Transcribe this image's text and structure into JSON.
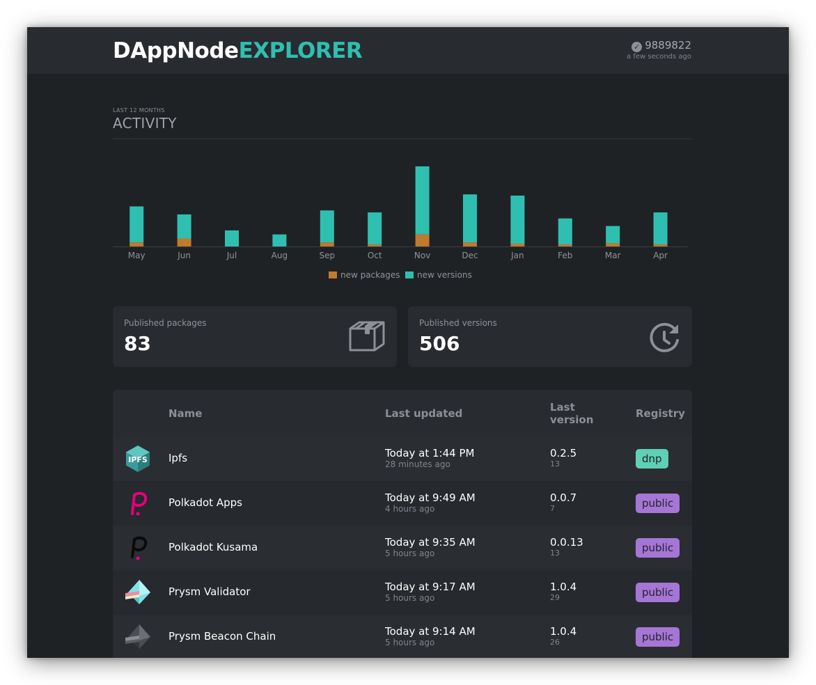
{
  "header": {
    "logo_main": "DAppNode",
    "logo_accent": "EXPLORER",
    "block_number": "9889822",
    "block_time": "a few seconds ago"
  },
  "activity": {
    "subtitle": "LAST 12 MONTHS",
    "title": "ACTIVITY"
  },
  "chart_data": {
    "type": "bar",
    "stacked": true,
    "categories": [
      "May",
      "Jun",
      "Jul",
      "Aug",
      "Sep",
      "Oct",
      "Nov",
      "Dec",
      "Jan",
      "Feb",
      "Mar",
      "Apr"
    ],
    "series": [
      {
        "name": "new packages",
        "color": "#c07a2c",
        "values": [
          1,
          2,
          0,
          0,
          1,
          0.5,
          3,
          1,
          0.7,
          0.5,
          0.8,
          0.5
        ]
      },
      {
        "name": "new versions",
        "color": "#2fbfb0",
        "values": [
          9,
          6,
          4,
          3,
          8,
          8,
          17,
          12,
          12,
          6.5,
          4.3,
          8
        ]
      }
    ],
    "legend_position": "bottom-center",
    "ylim": [
      0,
      20
    ],
    "grid": false
  },
  "stats": {
    "packages_label": "Published packages",
    "packages_value": "83",
    "versions_label": "Published versions",
    "versions_value": "506"
  },
  "table": {
    "headers": {
      "name": "Name",
      "updated": "Last updated",
      "version_line1": "Last",
      "version_line2": "version",
      "registry": "Registry"
    },
    "rows": [
      {
        "icon": "ipfs-icon",
        "name": "Ipfs",
        "updated": "Today at 1:44 PM",
        "ago": "28 minutes ago",
        "version": "0.2.5",
        "count": "13",
        "registry": "dnp",
        "registry_color": "#5fcfb5"
      },
      {
        "icon": "polkadot-apps-icon",
        "name": "Polkadot Apps",
        "updated": "Today at 9:49 AM",
        "ago": "4 hours ago",
        "version": "0.0.7",
        "count": "7",
        "registry": "public",
        "registry_color": "#a676d6"
      },
      {
        "icon": "polkadot-kusama-icon",
        "name": "Polkadot Kusama",
        "updated": "Today at 9:35 AM",
        "ago": "5 hours ago",
        "version": "0.0.13",
        "count": "13",
        "registry": "public",
        "registry_color": "#a676d6"
      },
      {
        "icon": "prysm-validator-icon",
        "name": "Prysm Validator",
        "updated": "Today at 9:17 AM",
        "ago": "5 hours ago",
        "version": "1.0.4",
        "count": "29",
        "registry": "public",
        "registry_color": "#a676d6"
      },
      {
        "icon": "prysm-beacon-chain-icon",
        "name": "Prysm Beacon Chain",
        "updated": "Today at 9:14 AM",
        "ago": "5 hours ago",
        "version": "1.0.4",
        "count": "26",
        "registry": "public",
        "registry_color": "#a676d6"
      }
    ]
  }
}
